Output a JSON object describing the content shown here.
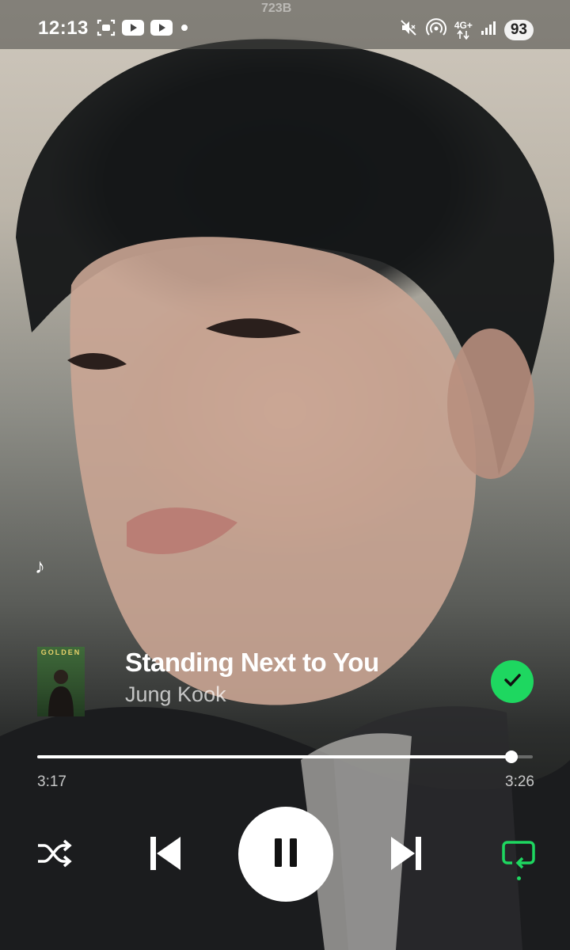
{
  "status_bar": {
    "time": "12:13",
    "carrier": "723B",
    "network_label": "4G+",
    "battery": "93",
    "icons": [
      "screenshot-icon",
      "youtube-icon",
      "youtube-icon",
      "dot-icon",
      "mute-icon",
      "hotspot-icon",
      "network-arrows-icon",
      "signal-icon"
    ]
  },
  "now_playing": {
    "title": "Standing Next to You",
    "artist": "Jung Kook",
    "album_art_text": "GOLDEN",
    "liked": true,
    "lyrics_icon": "music-note-icon"
  },
  "progress": {
    "elapsed": "3:17",
    "total": "3:26",
    "fraction": 0.957
  },
  "controls": {
    "shuffle": "shuffle-icon",
    "previous": "skip-previous-icon",
    "play_state": "pause-icon",
    "next": "skip-next-icon",
    "repeat": "repeat-icon"
  },
  "colors": {
    "accent": "#1ed760",
    "text_primary": "#ffffff"
  }
}
